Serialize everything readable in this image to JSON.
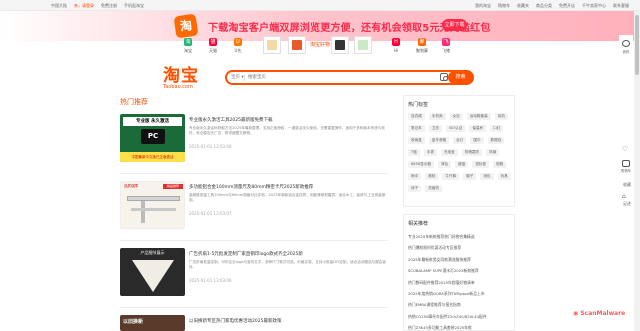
{
  "topbar": {
    "left": [
      "中国大陆",
      "亲，请登录",
      "免费注册",
      "手机逛淘宝"
    ],
    "right": [
      "我的淘宝",
      "购物车",
      "收藏夹",
      "商品分类",
      "免费开店",
      "千牛卖家中心",
      "联系客服"
    ]
  },
  "promo": {
    "icon": "淘",
    "text": "下载淘宝客户端双屏浏览更方便，还有机会领取5元无门槛红包",
    "button": "立即下载"
  },
  "apps": [
    {
      "label": "淘宝",
      "icon": "淘",
      "color": "#22b573"
    },
    {
      "label": "天猫",
      "icon": "猫",
      "color": "#ff0036"
    },
    {
      "label": "U先",
      "icon": "U",
      "color": "#ff7a00"
    },
    {
      "label": "Hi",
      "icon": "H",
      "color": "#ff0036"
    },
    {
      "label": "聚划算",
      "icon": "聚",
      "color": "#ff6600"
    },
    {
      "label": "飞猪",
      "icon": "飞",
      "color": "#ff2a7a"
    }
  ],
  "mid_label": "淘宝好物",
  "logo": {
    "name": "淘宝",
    "sub": "Taobao.com"
  },
  "search": {
    "category": "宝贝",
    "placeholder": "搜索宝贝",
    "button": "搜索"
  },
  "section_title": "热门推荐",
  "articles": [
    {
      "title": "专业版永久激活工具2025最新版免费下载",
      "desc": "专业版永久激活码获取方法2025年最新整理，支持正版授权，一键激活永久使用，无需重复操作，适用于多种版本系统与软件，安全稳定无广告，附详细图文教程。",
      "date": "2025-01-01 13:03:08",
      "thumb": {
        "top": "专业版 永久激活",
        "mid": "PC",
        "bot": "中国最新中文版已正版激活"
      }
    },
    {
      "title": "多功能铝合金100mm测量尺及80mm精密卡尺2025新款推荐",
      "desc": "高精度测量工具100mm与80mm规格对比评测，2025年新款铝合金材质，刻度清晰耐磨损，适合木工、装修与工业测量使用。",
      "date": "2025-01-01 13:03:07",
      "thumb": {
        "brand": "品质保障",
        "tag": "精品推荐"
      }
    },
    {
      "title": "广告折扇1-5元批发定制厂家直销印logo款式齐全2025新",
      "desc": "广告折扇批量定制，可印企业logo与宣传文字，多种尺寸款式可选，价格实惠，支持小批量DIY定制，适合活动赠品与展会宣传。",
      "date": "2025-01-01 13:03:06",
      "thumb": {
        "top": "产品细节展示"
      }
    },
    {
      "title": "以旧换新专区热门家电优惠活动2025最新政策",
      "desc": "",
      "date": "",
      "thumb": {
        "top": "以旧换新"
      }
    }
  ],
  "panel_tags": {
    "title": "热门标签",
    "tags": [
      "连衣裙",
      "手机壳",
      "女包",
      "运动鞋套装",
      "耳机",
      "笔记本",
      "卫衣",
      "ISO认证",
      "保温杯",
      "口红",
      "收纳盒",
      "蓝牙音箱",
      "台灯",
      "围巾",
      "数据线",
      "T恤",
      "手表",
      "充电宝",
      "防晒霜衣",
      "风扇",
      "6658显示器",
      "背包",
      "键盘",
      "鼠标垫",
      "拖鞋",
      "雨伞",
      "抱枕",
      "牛仔裤",
      "帽子",
      "钱包",
      "玩具",
      "袜子",
      "洗面奶"
    ]
  },
  "panel_list": {
    "title": "相关推荐",
    "items": [
      "专业2025年新款推荐热门好物合集精选",
      "热门爆款限时优惠活动专区推荐",
      "2025年最新款男女同款潮流服饰推荐",
      "SCUBALAMP SUPE潜水灯2025新款推荐",
      "热门数码配件推荐2025年超值好物清单",
      "2025年度热销DORA系列TNTspace新品上市",
      "热门EMBA课程推荐与报名指南",
      "热销CG250摩托车配件Z20/Z40/820L44配件",
      "热门Z3K45多功能工具套装2025年款"
    ]
  },
  "rbar": [
    {
      "name": "user-icon",
      "label": "我的"
    },
    {
      "name": "cart-icon",
      "label": "购物车"
    },
    {
      "name": "heart-icon",
      "label": "收藏"
    },
    {
      "name": "footprint-icon",
      "label": "足迹"
    }
  ],
  "watermark": "ScanMalware"
}
